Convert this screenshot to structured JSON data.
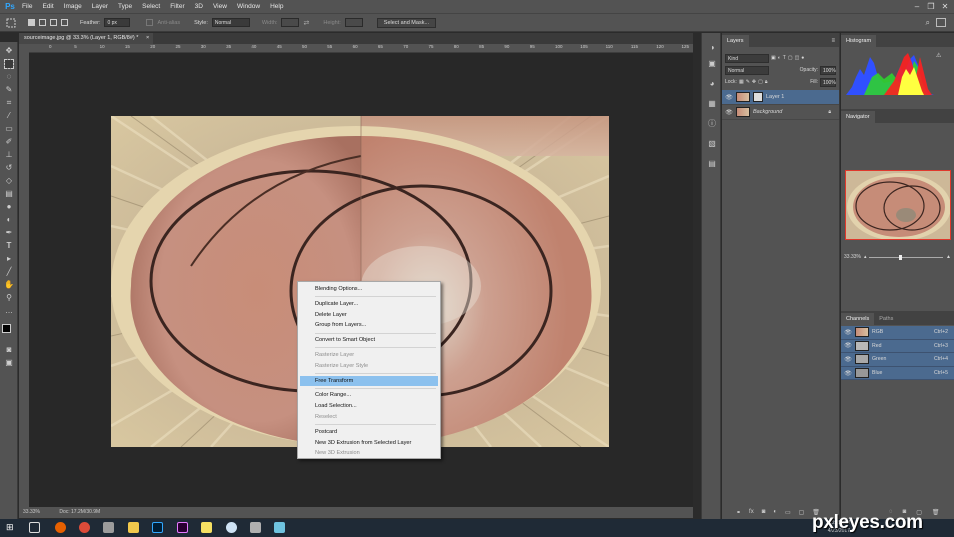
{
  "app": {
    "logo": "Ps"
  },
  "menubar": {
    "items": [
      "File",
      "Edit",
      "Image",
      "Layer",
      "Type",
      "Select",
      "Filter",
      "3D",
      "View",
      "Window",
      "Help"
    ]
  },
  "window_controls": {
    "minimize": "–",
    "restore": "❐",
    "close": "✕"
  },
  "options": {
    "feather_label": "Feather:",
    "feather_value": "0 px",
    "antialias_label": "Anti-alias",
    "style_label": "Style:",
    "style_value": "Normal",
    "width_label": "Width:",
    "height_label": "Height:",
    "select_mask_button": "Select and Mask..."
  },
  "document": {
    "tab_title": "sourceimage.jpg @ 33.3% (Layer 1, RGB/8#) *",
    "close_glyph": "×",
    "ruler_ticks": [
      "0",
      "5",
      "10",
      "15",
      "20",
      "25",
      "30",
      "35",
      "40",
      "45",
      "50",
      "55",
      "60",
      "65",
      "70",
      "75",
      "80",
      "85",
      "90",
      "95",
      "100",
      "105",
      "110",
      "115",
      "120",
      "125"
    ]
  },
  "status": {
    "zoom": "33.33%",
    "doc": "Doc: 17.2M/30.9M"
  },
  "context_menu": {
    "groups": [
      [
        {
          "label": "Blending Options...",
          "disabled": false
        }
      ],
      [
        {
          "label": "Duplicate Layer...",
          "disabled": false
        },
        {
          "label": "Delete Layer",
          "disabled": false
        },
        {
          "label": "Group from Layers...",
          "disabled": false
        }
      ],
      [
        {
          "label": "Convert to Smart Object",
          "disabled": false
        }
      ],
      [
        {
          "label": "Rasterize Layer",
          "disabled": true
        },
        {
          "label": "Rasterize Layer Style",
          "disabled": true
        }
      ],
      [
        {
          "label": "Free Transform",
          "disabled": false,
          "highlighted": true
        }
      ],
      [
        {
          "label": "Color Range...",
          "disabled": false
        },
        {
          "label": "Load Selection...",
          "disabled": false
        },
        {
          "label": "Reselect",
          "disabled": true
        }
      ],
      [
        {
          "label": "Postcard",
          "disabled": false
        },
        {
          "label": "New 3D Extrusion from Selected Layer",
          "disabled": false
        },
        {
          "label": "New 3D Extrusion",
          "disabled": true
        }
      ]
    ]
  },
  "layers_panel": {
    "tab": "Layers",
    "kind_filter": "Kind",
    "blend_mode": "Normal",
    "opacity_label": "Opacity:",
    "opacity_value": "100%",
    "lock_label": "Lock:",
    "fill_label": "Fill:",
    "fill_value": "100%",
    "layers": [
      {
        "name": "Layer 1",
        "selected": true
      },
      {
        "name": "Background",
        "selected": false,
        "italic": true
      }
    ]
  },
  "histogram_panel": {
    "tab": "Histogram",
    "warning_glyph": "⚠"
  },
  "navigator_panel": {
    "tab": "Navigator",
    "zoom": "33.33%"
  },
  "channels_panel": {
    "tabs": [
      "Channels",
      "Paths"
    ],
    "channels": [
      {
        "name": "RGB",
        "shortcut": "Ctrl+2"
      },
      {
        "name": "Red",
        "shortcut": "Ctrl+3"
      },
      {
        "name": "Green",
        "shortcut": "Ctrl+4"
      },
      {
        "name": "Blue",
        "shortcut": "Ctrl+5"
      }
    ]
  },
  "taskbar": {
    "time": "3:15 PM",
    "date": "4/23/2017"
  },
  "watermark": {
    "text": "pxleyes.com"
  },
  "colors": {
    "accent": "#31a8ff",
    "selection": "#4b6a8f",
    "highlight": "#8cc1ee",
    "nav_frame": "#e0382c"
  }
}
